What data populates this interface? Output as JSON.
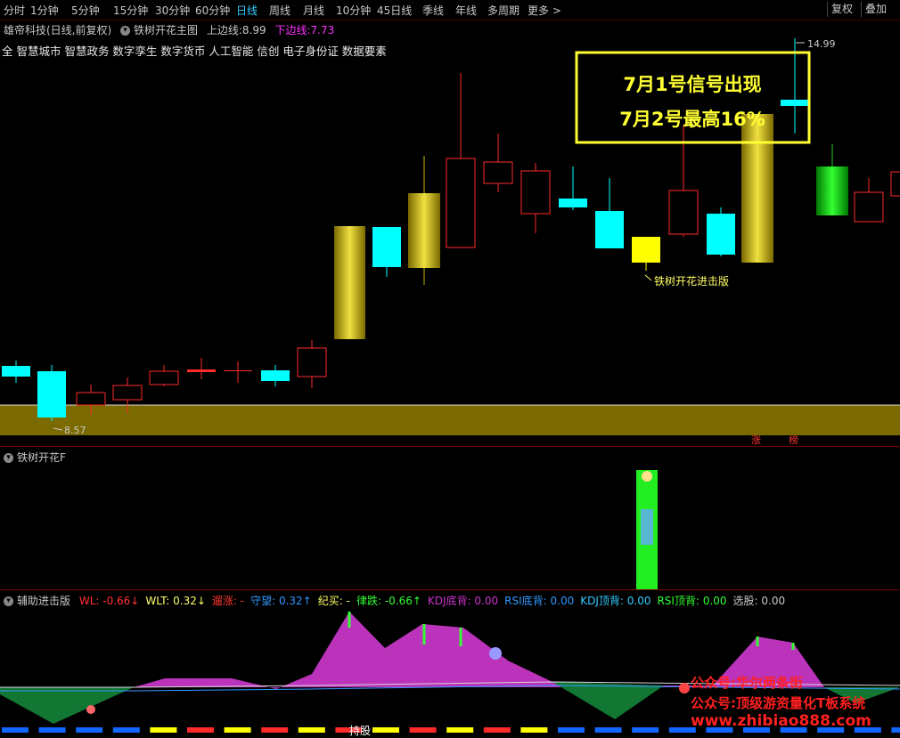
{
  "periods": [
    "分时",
    "1分钟",
    "5分钟",
    "15分钟",
    "30分钟",
    "60分钟",
    "日线",
    "周线",
    "月线",
    "10分钟",
    "45日线",
    "季线",
    "年线",
    "多周期",
    "更多 >"
  ],
  "active_period": "日线",
  "top_buttons": [
    "复权",
    "叠加"
  ],
  "header": {
    "stock": "雄帝科技(日线,前复权)",
    "indicator": "铁树开花主图",
    "upper_label": "上边线:",
    "upper_value": "8.99",
    "lower_label": "下边线:",
    "lower_value": "7.73"
  },
  "concepts_line": "全 智慧城市 智慧政务 数字孪生 数字货币 人工智能 信创 电子身份证 数据要素",
  "annotation_box": {
    "line1": "7月1号信号出现",
    "line2": "7月2号最高16%"
  },
  "labels": {
    "high_price": "14.99",
    "low_price": "8.57",
    "signal_label": "铁树开花进击版",
    "tag_zhang": "涨",
    "tag_bang": "榜"
  },
  "panel2": {
    "title": "铁树开花F"
  },
  "panel3": {
    "title": "辅助进击版",
    "items": [
      {
        "label": "WL:",
        "value": "-0.66",
        "arrow": "↓",
        "color": "#ff3333"
      },
      {
        "label": "WLT:",
        "value": "0.32",
        "arrow": "↓",
        "color": "#ffff66"
      },
      {
        "label": "遛涨:",
        "value": "-",
        "arrow": "",
        "color": "#ff3333"
      },
      {
        "label": "守望:",
        "value": "0.32",
        "arrow": "↑",
        "color": "#3399ff"
      },
      {
        "label": "纪买:",
        "value": "-",
        "arrow": "",
        "color": "#ffff66"
      },
      {
        "label": "律跌:",
        "value": "-0.66",
        "arrow": "↑",
        "color": "#33ff33"
      },
      {
        "label": "KDJ底背:",
        "value": "0.00",
        "arrow": "",
        "color": "#cc33cc"
      },
      {
        "label": "RSI底背:",
        "value": "0.00",
        "arrow": "",
        "color": "#3399ff"
      },
      {
        "label": "KDJ顶背:",
        "value": "0.00",
        "arrow": "",
        "color": "#33ccff"
      },
      {
        "label": "RSI顶背:",
        "value": "0.00",
        "arrow": "",
        "color": "#33ff33"
      },
      {
        "label": "选股:",
        "value": "0.00",
        "arrow": "",
        "color": "#c8c8c8"
      }
    ],
    "bottom_label": "持股"
  },
  "watermark": {
    "line1": "公众号:华尔两条街",
    "line2": "公众号:顶级游资量化T板系统",
    "line3": "www.zhibiao888.com"
  },
  "colors": {
    "up_red": "#ff2a2a",
    "cyan": "#00ffff",
    "gold": "#c8b400",
    "yellow": "#ffff00",
    "green_signal": "#33ff33",
    "magenta": "#cc33cc"
  }
}
